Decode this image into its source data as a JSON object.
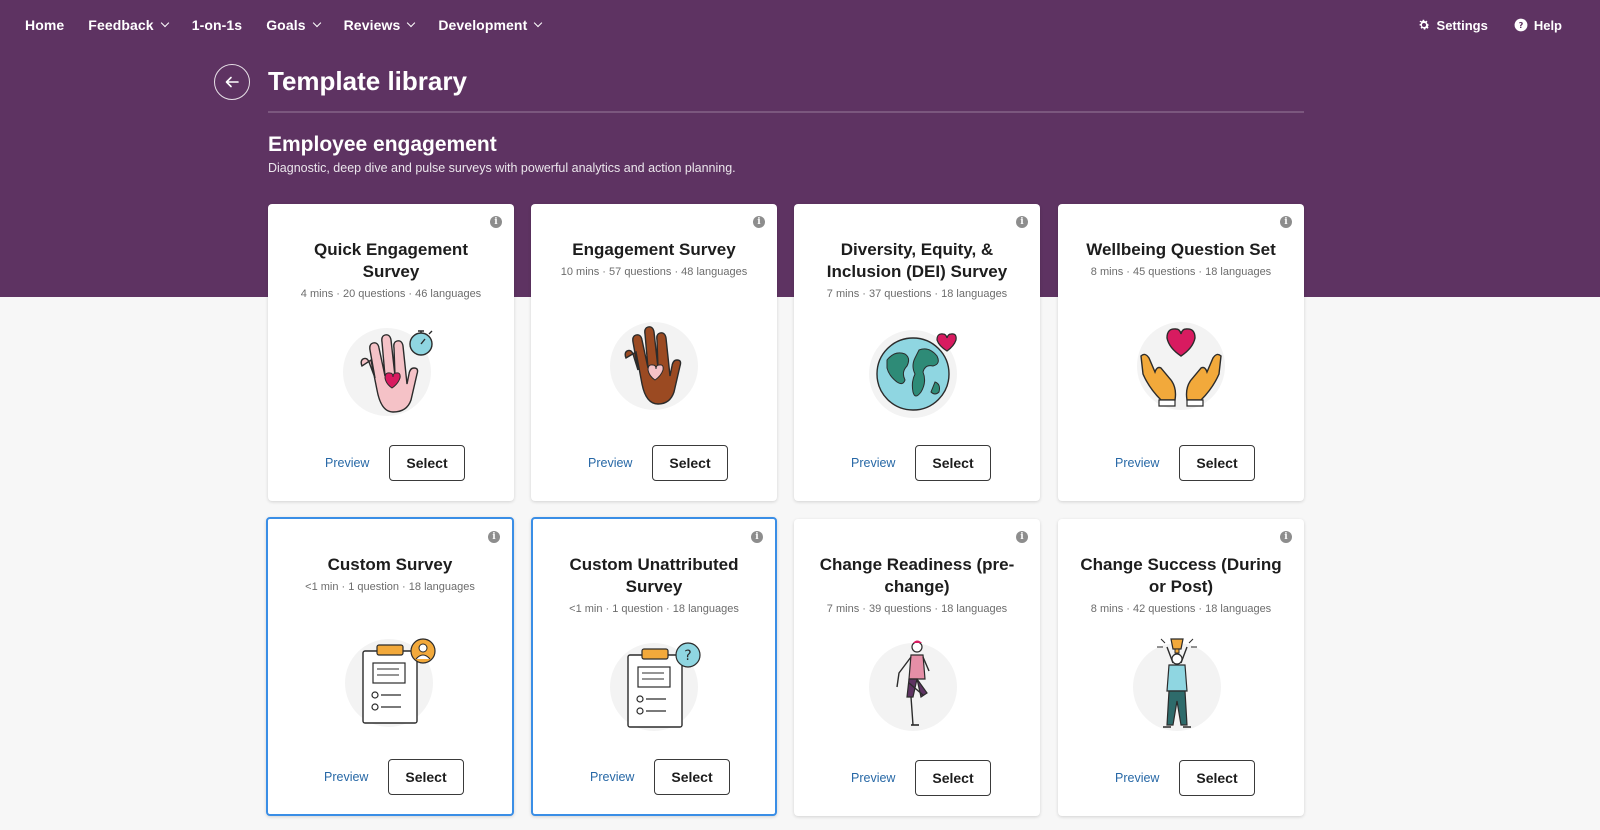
{
  "nav": {
    "items": [
      {
        "label": "Home",
        "has_menu": false
      },
      {
        "label": "Feedback",
        "has_menu": true
      },
      {
        "label": "1-on-1s",
        "has_menu": false
      },
      {
        "label": "Goals",
        "has_menu": true
      },
      {
        "label": "Reviews",
        "has_menu": true
      },
      {
        "label": "Development",
        "has_menu": true
      }
    ],
    "settings": "Settings",
    "help": "Help"
  },
  "page": {
    "title": "Template library"
  },
  "section": {
    "title": "Employee engagement",
    "description": "Diagnostic, deep dive and pulse surveys with powerful analytics and action planning."
  },
  "cards": [
    {
      "title": "Quick Engagement Survey",
      "meta": "4 mins · 20 questions · 46 languages",
      "icon": "hand-heart-stopwatch-icon",
      "preview": "Preview",
      "select": "Select",
      "selected": false
    },
    {
      "title": "Engagement Survey",
      "meta": "10 mins · 57 questions · 48 languages",
      "icon": "raised-hand-heart-icon",
      "preview": "Preview",
      "select": "Select",
      "selected": false
    },
    {
      "title": "Diversity, Equity, & Inclusion (DEI) Survey",
      "meta": "7 mins · 37 questions · 18 languages",
      "icon": "globe-heart-icon",
      "preview": "Preview",
      "select": "Select",
      "selected": false
    },
    {
      "title": "Wellbeing Question Set",
      "meta": "8 mins · 45 questions · 18 languages",
      "icon": "hands-holding-heart-icon",
      "preview": "Preview",
      "select": "Select",
      "selected": false
    },
    {
      "title": "Custom Survey",
      "meta": "<1 min · 1 question · 18 languages",
      "icon": "clipboard-person-icon",
      "preview": "Preview",
      "select": "Select",
      "selected": true
    },
    {
      "title": "Custom Unattributed Survey",
      "meta": "<1 min · 1 question · 18 languages",
      "icon": "clipboard-question-icon",
      "preview": "Preview",
      "select": "Select",
      "selected": true
    },
    {
      "title": "Change Readiness (pre-change)",
      "meta": "7 mins · 39 questions · 18 languages",
      "icon": "stretching-person-icon",
      "preview": "Preview",
      "select": "Select",
      "selected": false
    },
    {
      "title": "Change Success (During or Post)",
      "meta": "8 mins · 42 questions · 18 languages",
      "icon": "trophy-person-icon",
      "preview": "Preview",
      "select": "Select",
      "selected": false
    }
  ],
  "colors": {
    "header_bg": "#5e3362",
    "page_bg": "#f7f7f7",
    "link": "#2768a6",
    "selected_border": "#3a8ee6"
  }
}
